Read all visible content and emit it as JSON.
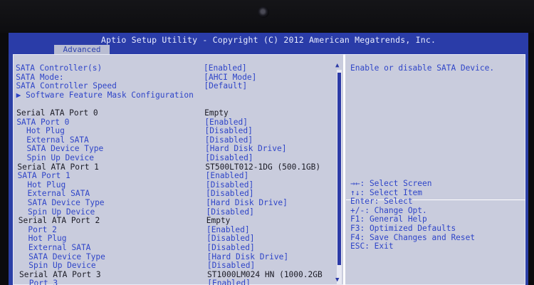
{
  "header": {
    "title": "Aptio Setup Utility - Copyright (C) 2012 American Megatrends, Inc.",
    "tab": "Advanced"
  },
  "settings": [
    {
      "label": "SATA Controller(s)",
      "value": "[Enabled]",
      "kind": "blue"
    },
    {
      "label": "SATA Mode:",
      "value": "[AHCI Mode]",
      "kind": "blue"
    },
    {
      "label": "SATA Controller Speed",
      "value": "[Default]",
      "kind": "blue"
    },
    {
      "label": "▶ Software Feature Mask Configuration",
      "value": "",
      "kind": "blue"
    },
    {
      "label": "",
      "value": "",
      "kind": "blank"
    },
    {
      "label": "Serial ATA Port 0",
      "value": "Empty",
      "kind": "dark"
    },
    {
      "label": "SATA Port 0",
      "value": "[Enabled]",
      "kind": "blue"
    },
    {
      "label": "  Hot Plug",
      "value": "[Disabled]",
      "kind": "blue"
    },
    {
      "label": "  External SATA",
      "value": "[Disabled]",
      "kind": "blue"
    },
    {
      "label": "  SATA Device Type",
      "value": "[Hard Disk Drive]",
      "kind": "blue"
    },
    {
      "label": "  Spin Up Device",
      "value": "[Disabled]",
      "kind": "blue"
    },
    {
      "label": "Serial ATA Port 1",
      "value": "ST500LT012-1DG (500.1GB)",
      "kind": "dark"
    },
    {
      "label": "SATA Port 1",
      "value": "[Enabled]",
      "kind": "blue"
    },
    {
      "label": "  Hot Plug",
      "value": "[Disabled]",
      "kind": "blue"
    },
    {
      "label": "  External SATA",
      "value": "[Disabled]",
      "kind": "blue"
    },
    {
      "label": "  SATA Device Type",
      "value": "[Hard Disk Drive]",
      "kind": "blue"
    },
    {
      "label": "  Spin Up Device",
      "value": "[Disabled]",
      "kind": "blue"
    },
    {
      "label": "Serial ATA Port 2",
      "value": "Empty",
      "kind": "dark"
    },
    {
      "label": "  Port 2",
      "value": "[Enabled]",
      "kind": "blue"
    },
    {
      "label": "  Hot Plug",
      "value": "[Disabled]",
      "kind": "blue"
    },
    {
      "label": "  External SATA",
      "value": "[Disabled]",
      "kind": "blue"
    },
    {
      "label": "  SATA Device Type",
      "value": "[Hard Disk Drive]",
      "kind": "blue"
    },
    {
      "label": "  Spin Up Device",
      "value": "[Disabled]",
      "kind": "blue"
    },
    {
      "label": "Serial ATA Port 3",
      "value": "ST1000LM024 HN (1000.2GB",
      "kind": "dark"
    },
    {
      "label": "  Port 3",
      "value": "[Enabled]",
      "kind": "blue"
    }
  ],
  "help": {
    "text": "Enable or disable SATA Device."
  },
  "keys": [
    "→←: Select Screen",
    "↑↓: Select Item",
    "Enter: Select",
    "+/-: Change Opt.",
    "F1: General Help",
    "F3: Optimized Defaults",
    "F4: Save Changes and Reset",
    "ESC: Exit"
  ]
}
